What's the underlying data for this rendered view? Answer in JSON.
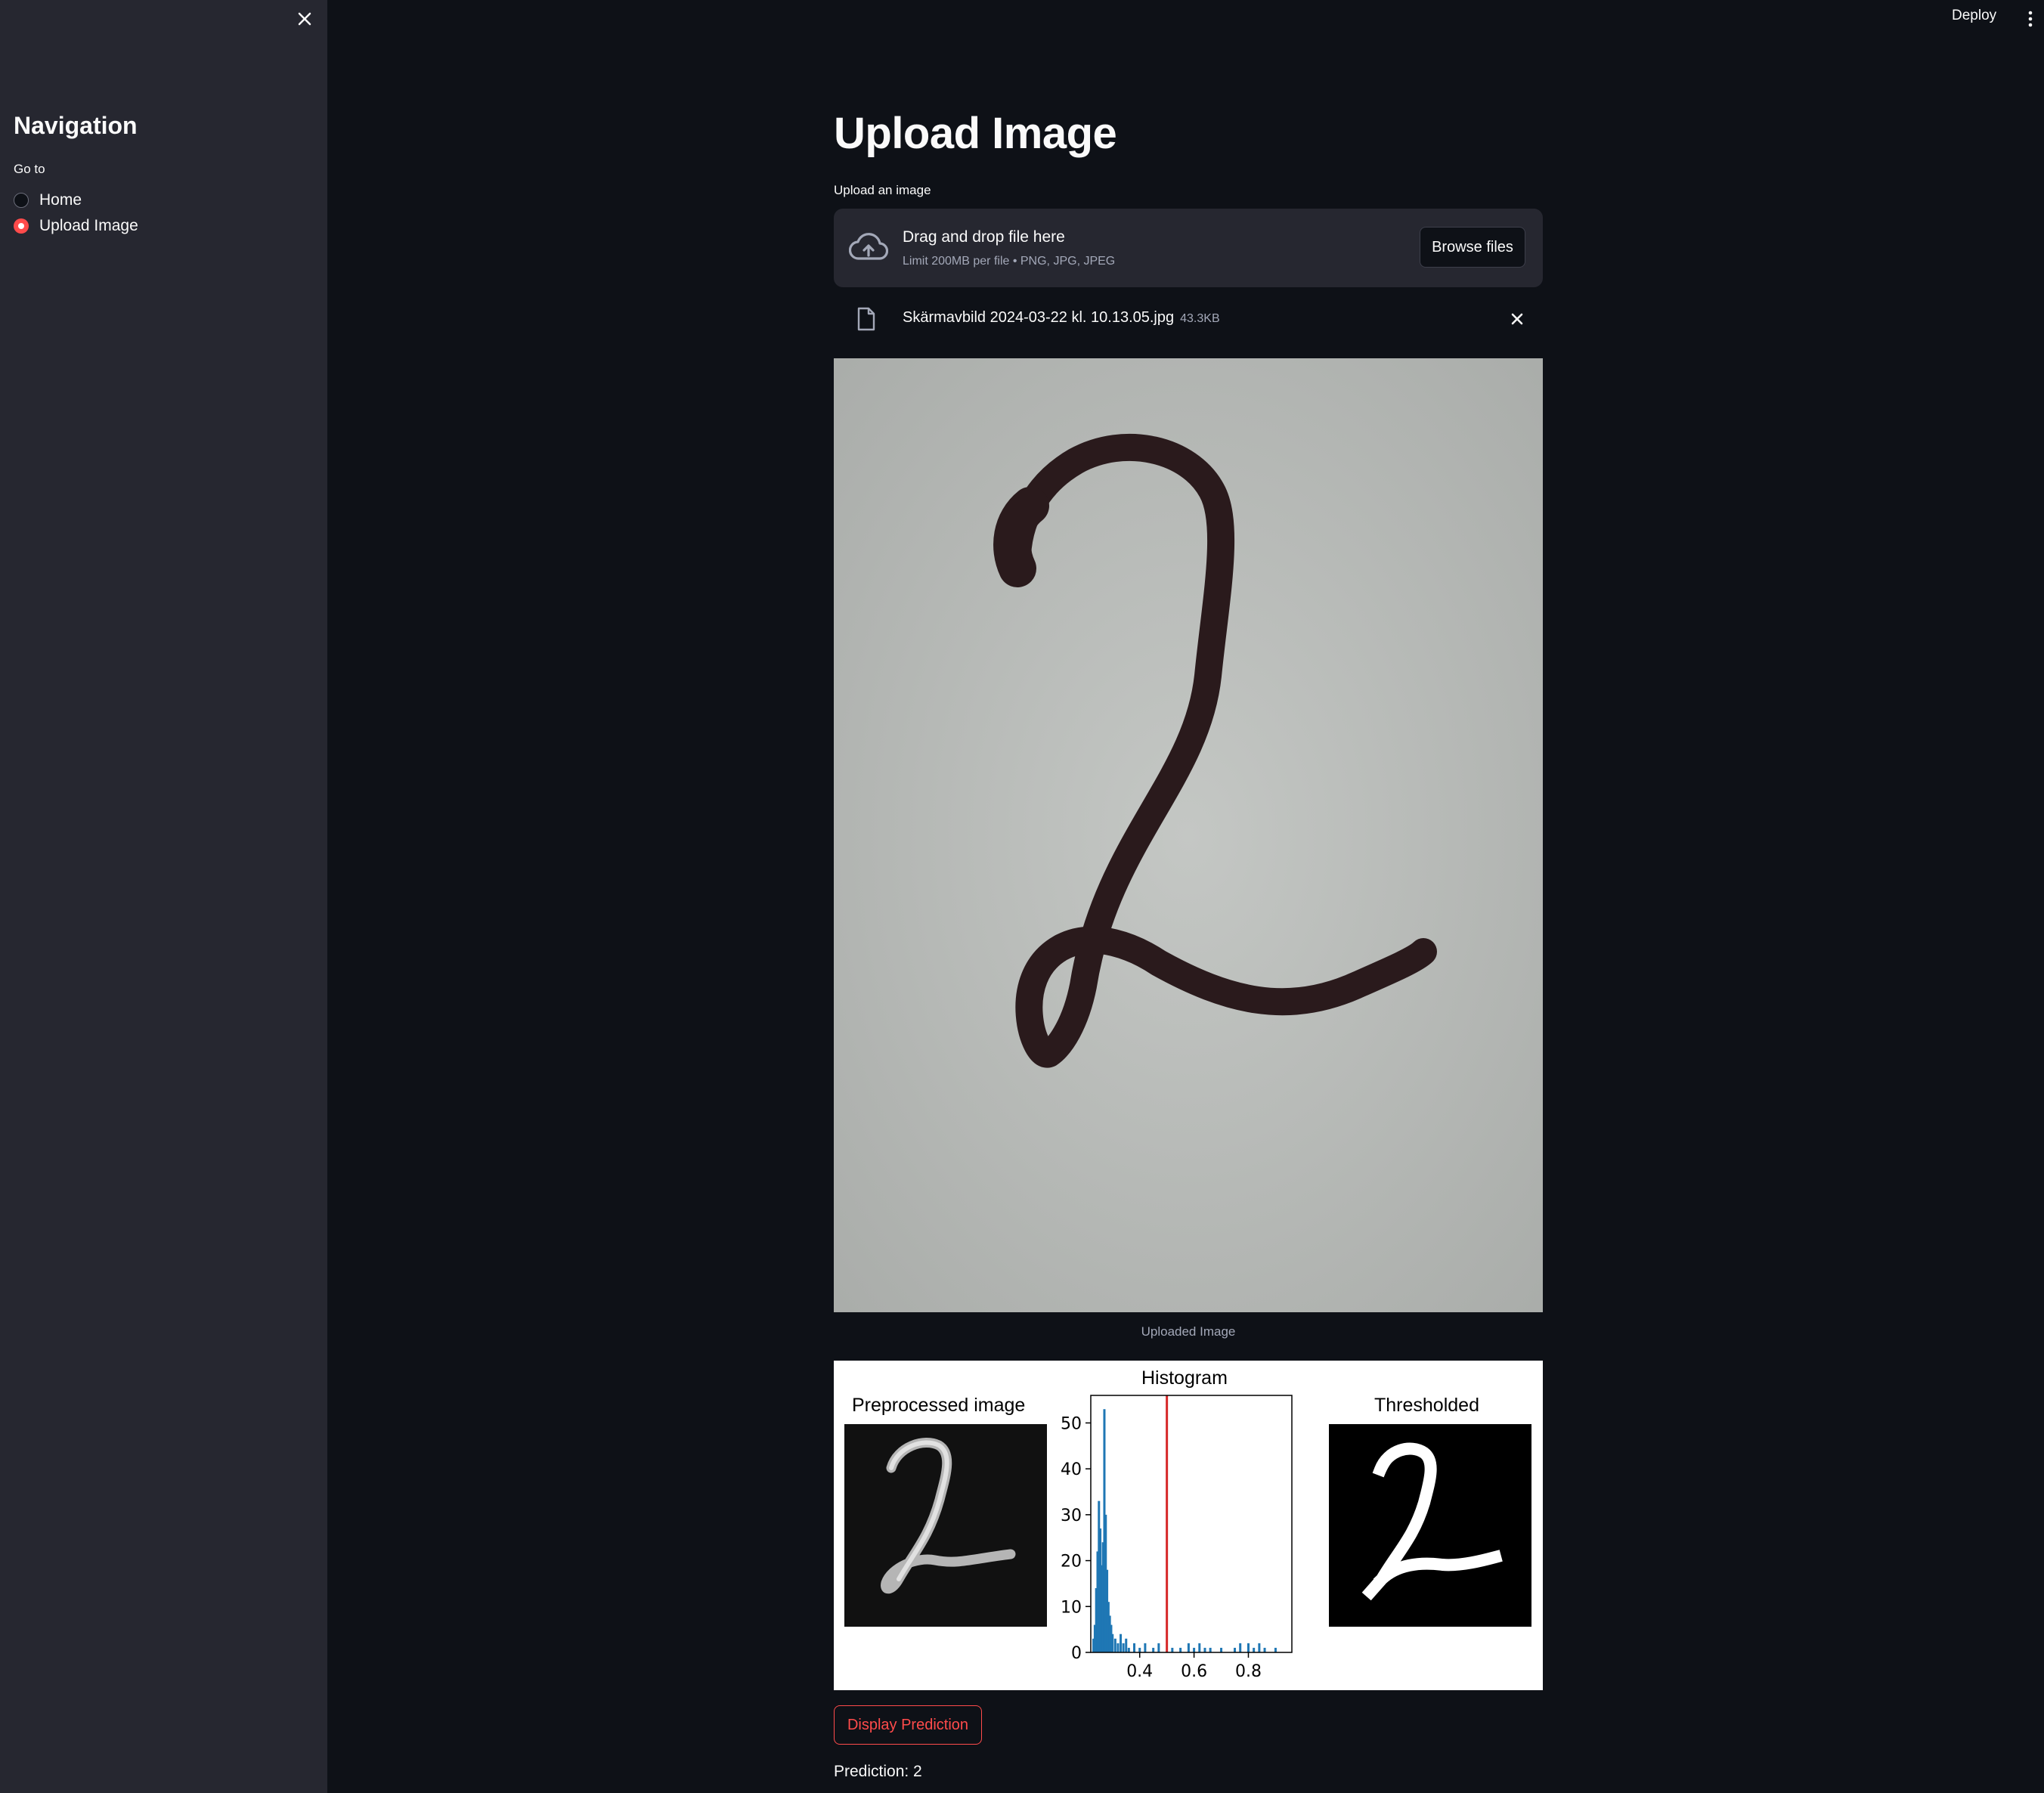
{
  "sidebar": {
    "title": "Navigation",
    "radio_label": "Go to",
    "options": [
      {
        "label": "Home",
        "selected": false
      },
      {
        "label": "Upload Image",
        "selected": true
      }
    ]
  },
  "header": {
    "deploy_label": "Deploy"
  },
  "main": {
    "title": "Upload Image",
    "uploader": {
      "label": "Upload an image",
      "drop_text": "Drag and drop file here",
      "limit_text": "Limit 200MB per file • PNG, JPG, JPEG",
      "browse_label": "Browse files"
    },
    "file": {
      "name": "Skärmavbild 2024-03-22 kl. 10.13.05.jpg",
      "size": "43.3KB"
    },
    "image_caption": "Uploaded Image",
    "figure": {
      "preprocessed_title": "Preprocessed image",
      "histogram_title": "Histogram",
      "thresholded_title": "Thresholded"
    },
    "predict_button": "Display Prediction",
    "prediction_text": "Prediction: 2"
  },
  "colors": {
    "accent": "#ff4b4b",
    "background": "#0e1117",
    "sidebar": "#262730",
    "histogram_bar": "#1f77b4",
    "threshold_line": "#d62728"
  },
  "chart_data": {
    "type": "bar",
    "title": "Histogram",
    "xlabel": "",
    "ylabel": "",
    "xlim": [
      0.22,
      0.96
    ],
    "ylim": [
      0,
      56
    ],
    "x_ticks": [
      "0.4",
      "0.6",
      "0.8"
    ],
    "y_ticks": [
      "0",
      "10",
      "20",
      "30",
      "40",
      "50"
    ],
    "threshold": 0.5,
    "x": [
      0.23,
      0.235,
      0.24,
      0.245,
      0.25,
      0.255,
      0.26,
      0.265,
      0.27,
      0.275,
      0.28,
      0.285,
      0.29,
      0.295,
      0.3,
      0.31,
      0.32,
      0.33,
      0.34,
      0.35,
      0.36,
      0.38,
      0.4,
      0.42,
      0.45,
      0.47,
      0.52,
      0.55,
      0.58,
      0.6,
      0.62,
      0.64,
      0.66,
      0.7,
      0.75,
      0.77,
      0.8,
      0.82,
      0.84,
      0.86,
      0.9
    ],
    "values": [
      3,
      6,
      14,
      22,
      33,
      27,
      19,
      24,
      53,
      30,
      18,
      11,
      8,
      6,
      4,
      3,
      2,
      4,
      2,
      3,
      1,
      2,
      1,
      2,
      1,
      2,
      1,
      1,
      2,
      1,
      2,
      1,
      1,
      1,
      1,
      2,
      2,
      1,
      2,
      1,
      1
    ]
  }
}
